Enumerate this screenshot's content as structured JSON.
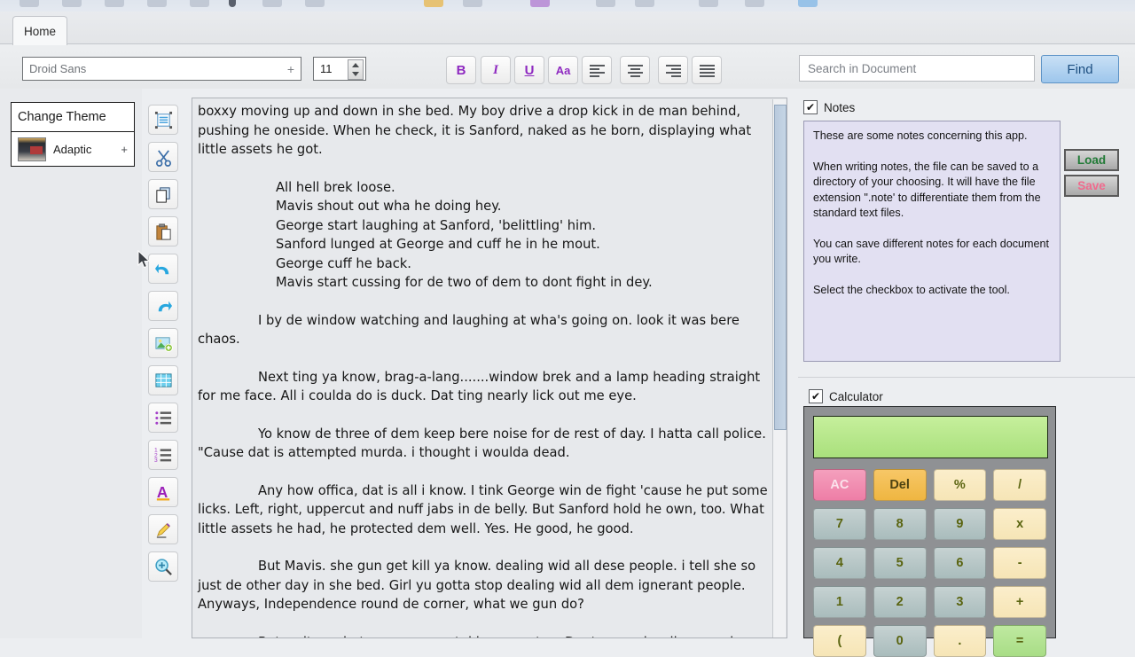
{
  "window": {
    "top_icon_strip": [
      {
        "name": "new-doc-icon",
        "color": "#b7bfcc"
      },
      {
        "name": "open-icon",
        "color": "#b7bfcc"
      },
      {
        "name": "save-icon",
        "color": "#b7bfcc"
      },
      {
        "name": "print-icon",
        "color": "#b7bfcc"
      },
      {
        "name": "export-icon",
        "color": "#b7bfcc"
      },
      {
        "name": "pin-icon",
        "color": "#2c3340"
      },
      {
        "name": "settings-icon",
        "color": "#b7bfcc"
      },
      {
        "name": "help-icon",
        "color": "#b7bfcc"
      },
      {
        "name": "bookmark-icon",
        "color": "#e8b54b"
      },
      {
        "name": "tag-icon",
        "color": "#b7bfcc"
      },
      {
        "name": "theme-icon",
        "color": "#b07ad0"
      },
      {
        "name": "spell-icon",
        "color": "#b7bfcc"
      },
      {
        "name": "view-icon",
        "color": "#b7bfcc"
      },
      {
        "name": "zoom-icon",
        "color": "#b7bfcc"
      },
      {
        "name": "info-icon",
        "color": "#b7bfcc"
      },
      {
        "name": "cloud-icon",
        "color": "#7fb5e6"
      }
    ]
  },
  "ribbon": {
    "tabs": [
      {
        "label": "Home",
        "active": true
      }
    ],
    "font": {
      "family_value": "Droid Sans",
      "family_expand": "+",
      "size_value": "11"
    },
    "format_buttons": [
      {
        "name": "bold-button",
        "label": "B",
        "style": "bold"
      },
      {
        "name": "italic-button",
        "label": "I",
        "style": "italic"
      },
      {
        "name": "underline-button",
        "label": "U",
        "style": "underline"
      },
      {
        "name": "font-color-button",
        "label": "Aa",
        "style": "color"
      }
    ],
    "align_buttons": [
      {
        "name": "align-left-button",
        "align": "left"
      },
      {
        "name": "align-center-button",
        "align": "center"
      },
      {
        "name": "align-right-button",
        "align": "right"
      },
      {
        "name": "align-justify-button",
        "align": "justify"
      }
    ],
    "search": {
      "placeholder": "Search in Document",
      "value": "",
      "find_label": "Find"
    }
  },
  "theme_panel": {
    "title": "Change Theme",
    "current_theme": "Adaptic",
    "expand_glyph": "+"
  },
  "vertical_tools": [
    {
      "name": "select-all-icon",
      "label": "Select All"
    },
    {
      "name": "cut-icon",
      "label": "Cut"
    },
    {
      "name": "copy-icon",
      "label": "Copy"
    },
    {
      "name": "paste-icon",
      "label": "Paste"
    },
    {
      "name": "undo-icon",
      "label": "Undo"
    },
    {
      "name": "redo-icon",
      "label": "Redo"
    },
    {
      "name": "insert-image-icon",
      "label": "Insert Image"
    },
    {
      "name": "insert-table-icon",
      "label": "Insert Table"
    },
    {
      "name": "bullet-list-icon",
      "label": "Bulleted List"
    },
    {
      "name": "numbered-list-icon",
      "label": "Numbered List"
    },
    {
      "name": "font-icon",
      "label": "Font"
    },
    {
      "name": "highlighter-icon",
      "label": "Highlight"
    },
    {
      "name": "zoom-in-icon",
      "label": "Zoom In"
    }
  ],
  "document": {
    "paragraphs": [
      {
        "type": "flow",
        "text": "boxxy moving up and down in she bed. My boy drive a drop kick in de man behind, pushing he oneside. When he check, it is Sanford, naked as he born, displaying what little assets he got."
      },
      {
        "type": "gap",
        "text": ""
      },
      {
        "type": "block",
        "text": "All hell brek loose."
      },
      {
        "type": "block",
        "text": "Mavis  shout out wha he doing hey."
      },
      {
        "type": "block",
        "text": "George start laughing at Sanford, 'belittling' him."
      },
      {
        "type": "block",
        "text": "Sanford lunged at George and cuff he in he mout."
      },
      {
        "type": "block",
        "text": "George cuff he back."
      },
      {
        "type": "block",
        "text": "Mavis start cussing for de two of dem to dont fight in dey."
      },
      {
        "type": "gap",
        "text": ""
      },
      {
        "type": "indent",
        "text": "I by de window watching and laughing at wha's going on. look it was bere chaos."
      },
      {
        "type": "gap",
        "text": ""
      },
      {
        "type": "indent",
        "text": "Next ting ya know, brag-a-lang.......window brek and a lamp heading straight for me face. All i coulda do is duck. Dat ting nearly lick out me eye."
      },
      {
        "type": "gap",
        "text": ""
      },
      {
        "type": "indent",
        "text": "Yo know de three of dem keep bere noise for de rest of day. I hatta call police. \"Cause dat is attempted murda. i thought i woulda dead."
      },
      {
        "type": "gap",
        "text": ""
      },
      {
        "type": "indent",
        "text": "Any how offica, dat is all i know. I tink George win de fight 'cause he put some licks. Left, right, uppercut and nuff jabs in de belly. But Sanford hold he own, too. What little assets he had, he protected dem well. Yes. He good, he good."
      },
      {
        "type": "gap",
        "text": ""
      },
      {
        "type": "indent",
        "text": "But Mavis. she gun get kill ya know. dealing wid all dese people. i tell she so just de other day in she bed. Girl yu gotta stop dealing wid all dem ignerant people. Anyways, Independence round de corner, what we gun do?"
      },
      {
        "type": "gap",
        "text": ""
      },
      {
        "type": "indent",
        "text": "But wait.....what wanna expect. i is a man too. Dont worry. i well covered."
      }
    ]
  },
  "notes": {
    "checkbox_checked": true,
    "check_glyph": "✔",
    "label": "Notes",
    "lines": [
      "These are some notes concerning this app.",
      "",
      "When writing notes, the file can be saved to a directory of your choosing. It will have the file extension \".note' to differentiate them from the standard text files.",
      "",
      "You can save different notes for each document you write.",
      "",
      "Select the checkbox to activate the tool."
    ],
    "load_label": "Load",
    "save_label": "Save",
    "load_color": "#217a36",
    "save_color": "#f06b8e"
  },
  "calculator": {
    "checkbox_checked": true,
    "check_glyph": "✔",
    "label": "Calculator",
    "display_value": "",
    "display_color": "#b6e78c",
    "keys": [
      {
        "label": "AC",
        "kind": "ac"
      },
      {
        "label": "Del",
        "kind": "del"
      },
      {
        "label": "%",
        "kind": "op"
      },
      {
        "label": "/",
        "kind": "op"
      },
      {
        "label": "7",
        "kind": "num"
      },
      {
        "label": "8",
        "kind": "num"
      },
      {
        "label": "9",
        "kind": "num"
      },
      {
        "label": "x",
        "kind": "op"
      },
      {
        "label": "4",
        "kind": "num"
      },
      {
        "label": "5",
        "kind": "num"
      },
      {
        "label": "6",
        "kind": "num"
      },
      {
        "label": "-",
        "kind": "op"
      },
      {
        "label": "1",
        "kind": "num"
      },
      {
        "label": "2",
        "kind": "num"
      },
      {
        "label": "3",
        "kind": "num"
      },
      {
        "label": "+",
        "kind": "op"
      },
      {
        "label": "(",
        "kind": "op"
      },
      {
        "label": "0",
        "kind": "num"
      },
      {
        "label": ".",
        "kind": "op"
      },
      {
        "label": "=",
        "kind": "eq"
      }
    ]
  },
  "colors": {
    "accent_purple": "#8e29c0",
    "find_blue": "#1d4f80",
    "notes_bg": "#e2e0f2",
    "calc_body": "#8f9194",
    "app_bg": "#eceef1"
  }
}
